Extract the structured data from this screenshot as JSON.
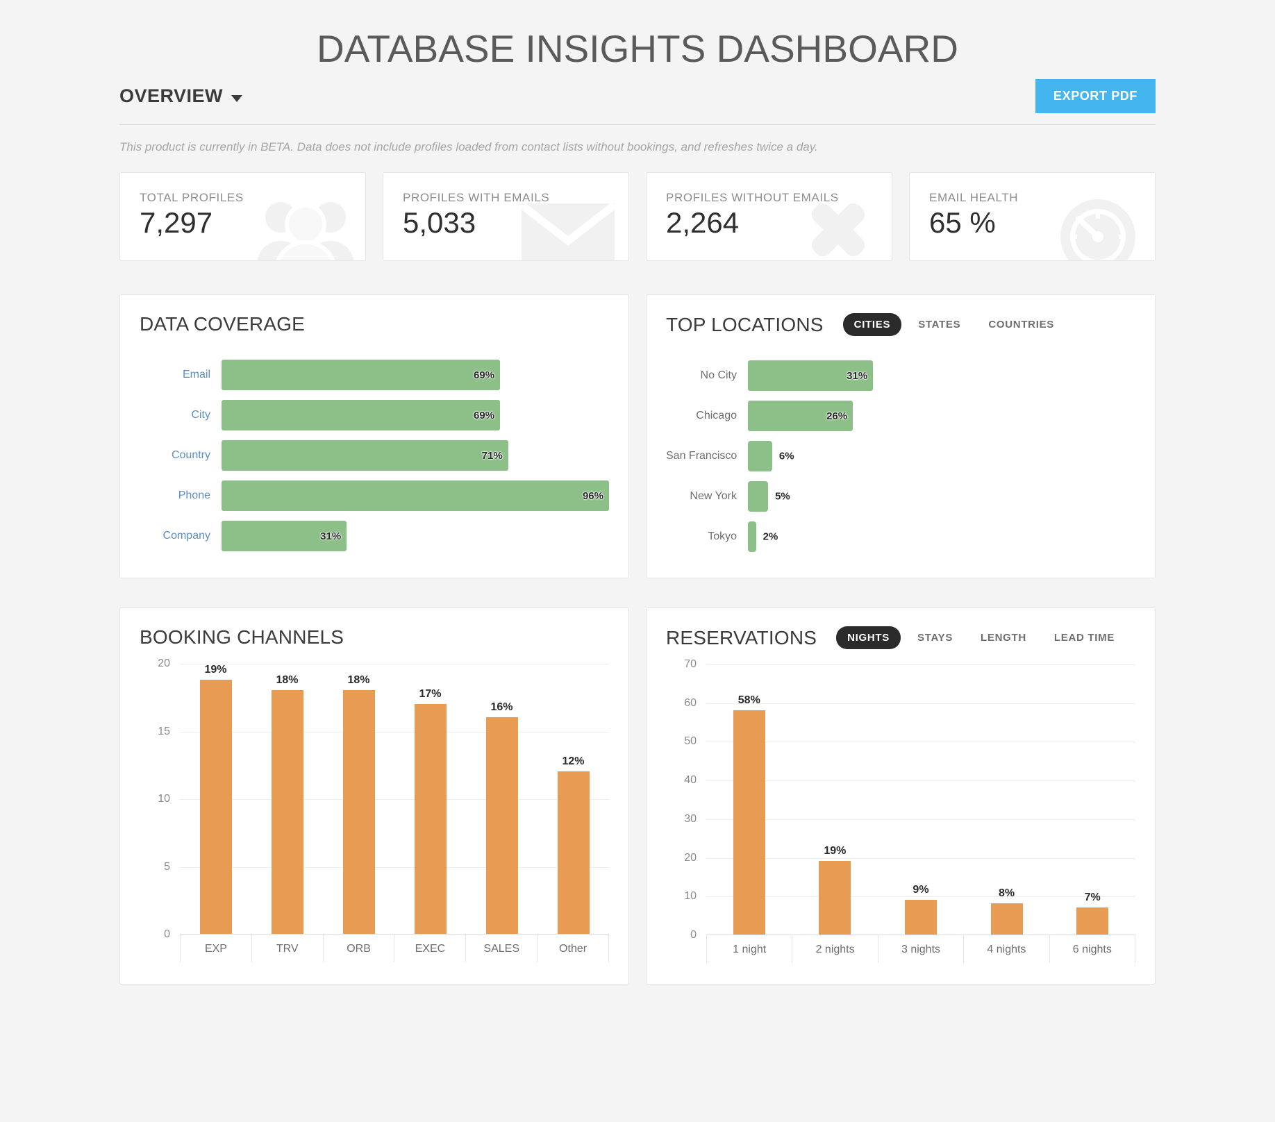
{
  "header": {
    "title": "DATABASE INSIGHTS DASHBOARD",
    "view_label": "OVERVIEW",
    "export_label": "EXPORT PDF",
    "beta_note": "This product is currently in BETA. Data does not include profiles loaded from contact lists without bookings, and refreshes twice a day."
  },
  "kpis": [
    {
      "label": "TOTAL PROFILES",
      "value": "7,297",
      "icon": "people-icon"
    },
    {
      "label": "PROFILES WITH EMAILS",
      "value": "5,033",
      "icon": "envelope-icon"
    },
    {
      "label": "PROFILES WITHOUT EMAILS",
      "value": "2,264",
      "icon": "cross-icon"
    },
    {
      "label": "EMAIL HEALTH",
      "value": "65 %",
      "icon": "gauge-icon"
    }
  ],
  "colors": {
    "accent_blue": "#45b5f0",
    "bar_green": "#8dbf88",
    "bar_orange": "#e89b52",
    "toggle_active": "#2b2b2b"
  },
  "panels": {
    "data_coverage": {
      "title": "DATA COVERAGE"
    },
    "top_locations": {
      "title": "TOP LOCATIONS",
      "toggles": [
        {
          "label": "CITIES",
          "active": true
        },
        {
          "label": "STATES",
          "active": false
        },
        {
          "label": "COUNTRIES",
          "active": false
        }
      ]
    },
    "booking_channels": {
      "title": "BOOKING CHANNELS"
    },
    "reservations": {
      "title": "RESERVATIONS",
      "toggles": [
        {
          "label": "NIGHTS",
          "active": true
        },
        {
          "label": "STAYS",
          "active": false
        },
        {
          "label": "LENGTH",
          "active": false
        },
        {
          "label": "LEAD TIME",
          "active": false
        }
      ]
    }
  },
  "chart_data": [
    {
      "id": "data_coverage",
      "type": "bar",
      "orientation": "horizontal",
      "title": "DATA COVERAGE",
      "categories": [
        "Email",
        "City",
        "Country",
        "Phone",
        "Company"
      ],
      "values": [
        69,
        69,
        71,
        96,
        31
      ],
      "labels": [
        "69%",
        "69%",
        "71%",
        "96%",
        "31%"
      ],
      "unit": "%",
      "max": 96,
      "grid": false,
      "label_position": "inside-right"
    },
    {
      "id": "top_locations",
      "type": "bar",
      "orientation": "horizontal",
      "title": "TOP LOCATIONS",
      "categories": [
        "No City",
        "Chicago",
        "San Francisco",
        "New York",
        "Tokyo"
      ],
      "values": [
        31,
        26,
        6,
        5,
        2
      ],
      "labels": [
        "31%",
        "26%",
        "6%",
        "5%",
        "2%"
      ],
      "unit": "%",
      "max": 96,
      "grid": false,
      "label_position": "inside-right"
    },
    {
      "id": "booking_channels",
      "type": "bar",
      "orientation": "vertical",
      "title": "BOOKING CHANNELS",
      "categories": [
        "EXP",
        "TRV",
        "ORB",
        "EXEC",
        "SALES",
        "Other"
      ],
      "values": [
        19,
        18,
        18,
        17,
        16,
        12
      ],
      "labels": [
        "19%",
        "18%",
        "18%",
        "17%",
        "16%",
        "12%"
      ],
      "xlabel": "",
      "ylabel": "",
      "ylim": [
        0,
        20
      ],
      "yticks": [
        0,
        5,
        10,
        15,
        20
      ],
      "grid": true
    },
    {
      "id": "reservations",
      "type": "bar",
      "orientation": "vertical",
      "title": "RESERVATIONS",
      "categories": [
        "1 night",
        "2 nights",
        "3 nights",
        "4 nights",
        "6 nights"
      ],
      "values": [
        58,
        19,
        9,
        8,
        7
      ],
      "labels": [
        "58%",
        "19%",
        "9%",
        "8%",
        "7%"
      ],
      "xlabel": "",
      "ylabel": "",
      "ylim": [
        0,
        70
      ],
      "yticks": [
        0,
        10,
        20,
        30,
        40,
        50,
        60,
        70
      ],
      "grid": true
    }
  ]
}
